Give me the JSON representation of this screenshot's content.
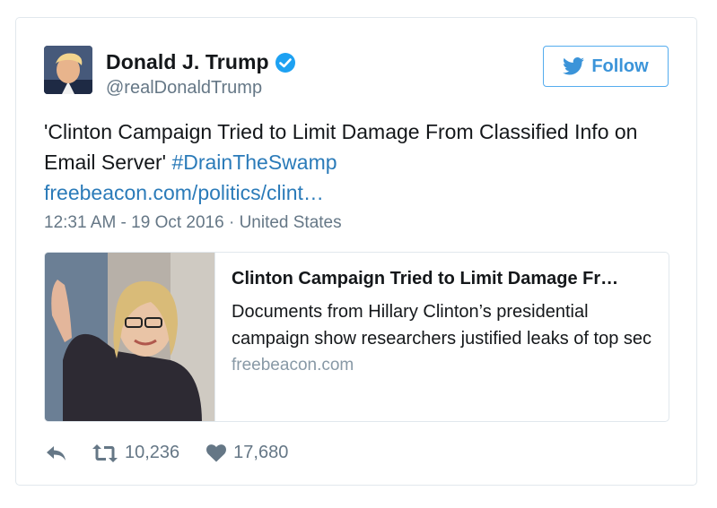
{
  "author": {
    "display_name": "Donald J. Trump",
    "handle": "@realDonaldTrump",
    "verified_icon": "verified-badge-icon",
    "avatar_icon": "avatar"
  },
  "follow_button": {
    "label": "Follow",
    "icon": "twitter-bird-icon"
  },
  "tweet": {
    "text_part1": "'Clinton Campaign Tried to Limit Damage From Classified Info on Email Server'",
    "hashtag": "#DrainTheSwamp",
    "link": "freebeacon.com/politics/clint…",
    "timestamp": "12:31 AM - 19 Oct 2016 · United States"
  },
  "link_card": {
    "title": "Clinton Campaign Tried to Limit Damage Fr…",
    "description": "Documents from Hillary Clinton’s presidential campaign show researchers justified leaks of top sec",
    "domain": "freebeacon.com"
  },
  "actions": {
    "reply_icon": "reply-icon",
    "retweet_icon": "retweet-icon",
    "retweet_count": "10,236",
    "like_icon": "heart-icon",
    "like_count": "17,680"
  },
  "colors": {
    "accent": "#2b7bb9",
    "follow_border": "#55acee",
    "verified": "#1da1f2",
    "muted": "#657786"
  }
}
